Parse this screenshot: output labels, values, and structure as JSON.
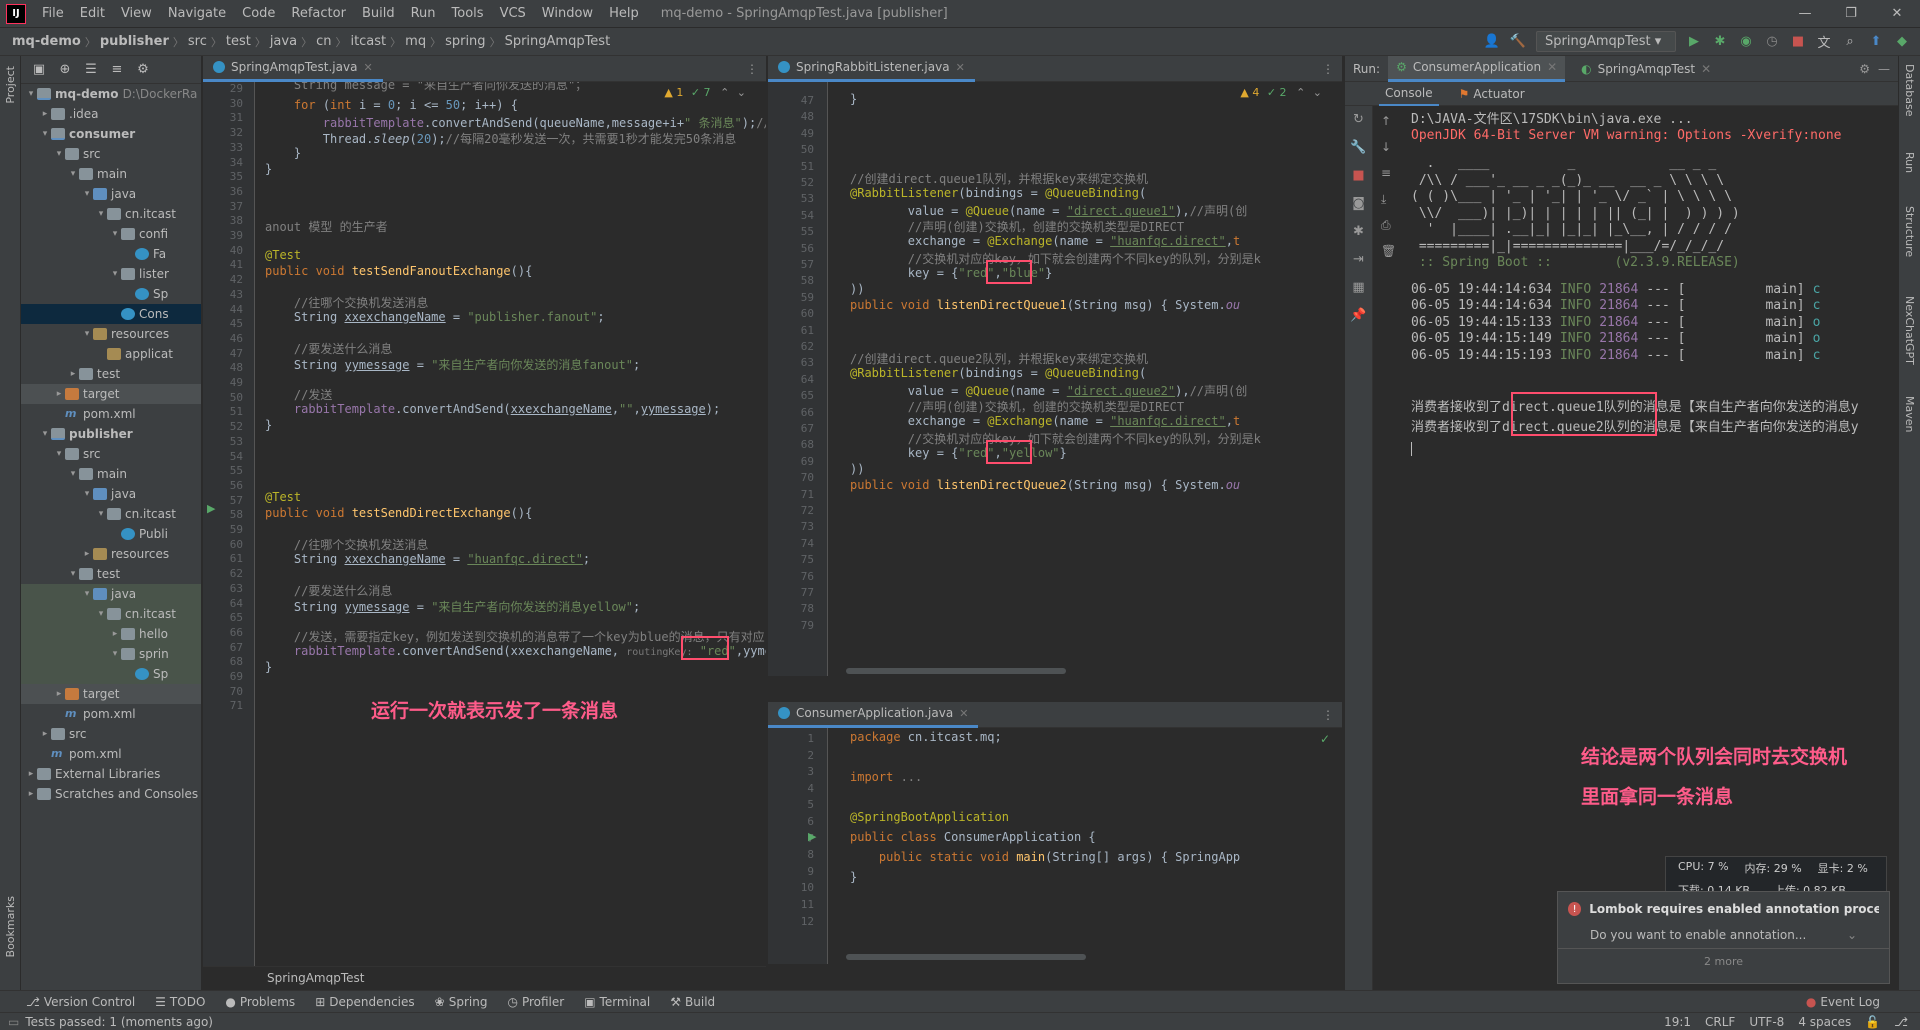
{
  "window": {
    "title": "mq-demo - SpringAmqpTest.java [publisher]",
    "logo": "IJ",
    "menu": [
      "File",
      "Edit",
      "View",
      "Navigate",
      "Code",
      "Refactor",
      "Build",
      "Run",
      "Tools",
      "VCS",
      "Window",
      "Help"
    ],
    "controls": [
      "—",
      "❐",
      "✕"
    ]
  },
  "breadcrumb": [
    "mq-demo",
    "publisher",
    "src",
    "test",
    "java",
    "cn",
    "itcast",
    "mq",
    "spring",
    "SpringAmqpTest"
  ],
  "run_config": "SpringAmqpTest",
  "left_strip": {
    "project": "Project",
    "bookmarks": "Bookmarks"
  },
  "right_strip": [
    "Database",
    "Run",
    "Structure",
    "NexChatGPT",
    "Maven"
  ],
  "project_tree": [
    {
      "depth": 0,
      "arrow": "▾",
      "icon": "mod",
      "label": "mq-demo",
      "suffix": "D:\\DockerRa",
      "bold": true
    },
    {
      "depth": 1,
      "arrow": "▸",
      "icon": "folder",
      "label": ".idea"
    },
    {
      "depth": 1,
      "arrow": "▾",
      "icon": "mod",
      "label": "consumer",
      "bold": true
    },
    {
      "depth": 2,
      "arrow": "▾",
      "icon": "folder",
      "label": "src"
    },
    {
      "depth": 3,
      "arrow": "▾",
      "icon": "folder",
      "label": "main"
    },
    {
      "depth": 4,
      "arrow": "▾",
      "icon": "src",
      "label": "java"
    },
    {
      "depth": 5,
      "arrow": "▾",
      "icon": "folder",
      "label": "cn.itcast"
    },
    {
      "depth": 6,
      "arrow": "▾",
      "icon": "folder",
      "label": "confi"
    },
    {
      "depth": 7,
      "arrow": "",
      "icon": "cls",
      "label": "Fa"
    },
    {
      "depth": 6,
      "arrow": "▾",
      "icon": "folder",
      "label": "lister"
    },
    {
      "depth": 7,
      "arrow": "",
      "icon": "cls",
      "label": "Sp"
    },
    {
      "depth": 6,
      "arrow": "",
      "icon": "cls",
      "label": "Cons",
      "selected": true
    },
    {
      "depth": 4,
      "arrow": "▾",
      "icon": "res",
      "label": "resources"
    },
    {
      "depth": 5,
      "arrow": "",
      "icon": "res",
      "label": "applicat"
    },
    {
      "depth": 3,
      "arrow": "▸",
      "icon": "folder",
      "label": "test"
    },
    {
      "depth": 2,
      "arrow": "▸",
      "icon": "target",
      "label": "target",
      "hl": true
    },
    {
      "depth": 2,
      "arrow": "",
      "icon": "pom",
      "label": "pom.xml"
    },
    {
      "depth": 1,
      "arrow": "▾",
      "icon": "mod",
      "label": "publisher",
      "bold": true
    },
    {
      "depth": 2,
      "arrow": "▾",
      "icon": "folder",
      "label": "src"
    },
    {
      "depth": 3,
      "arrow": "▾",
      "icon": "folder",
      "label": "main"
    },
    {
      "depth": 4,
      "arrow": "▾",
      "icon": "src",
      "label": "java"
    },
    {
      "depth": 5,
      "arrow": "▾",
      "icon": "folder",
      "label": "cn.itcast"
    },
    {
      "depth": 6,
      "arrow": "",
      "icon": "cls",
      "label": "Publi"
    },
    {
      "depth": 4,
      "arrow": "▸",
      "icon": "res",
      "label": "resources"
    },
    {
      "depth": 3,
      "arrow": "▾",
      "icon": "folder",
      "label": "test"
    },
    {
      "depth": 4,
      "arrow": "▾",
      "icon": "src",
      "label": "java",
      "test": true
    },
    {
      "depth": 5,
      "arrow": "▾",
      "icon": "folder",
      "label": "cn.itcast",
      "test": true
    },
    {
      "depth": 6,
      "arrow": "▸",
      "icon": "folder",
      "label": "hello",
      "test": true
    },
    {
      "depth": 6,
      "arrow": "▾",
      "icon": "folder",
      "label": "sprin",
      "test": true
    },
    {
      "depth": 7,
      "arrow": "",
      "icon": "cls",
      "label": "Sp",
      "test": true
    },
    {
      "depth": 2,
      "arrow": "▸",
      "icon": "target",
      "label": "target",
      "hl": true
    },
    {
      "depth": 2,
      "arrow": "",
      "icon": "pom",
      "label": "pom.xml"
    },
    {
      "depth": 1,
      "arrow": "▸",
      "icon": "folder",
      "label": "src"
    },
    {
      "depth": 1,
      "arrow": "",
      "icon": "pom",
      "label": "pom.xml"
    },
    {
      "depth": 0,
      "arrow": "▸",
      "icon": "folder",
      "label": "External Libraries"
    },
    {
      "depth": 0,
      "arrow": "▸",
      "icon": "folder",
      "label": "Scratches and Consoles"
    }
  ],
  "editor1": {
    "tab": "SpringAmqpTest.java",
    "inspections": {
      "warn": "▲ 1",
      "ok": "✓ 7"
    },
    "first_line": 29,
    "footer": "SpringAmqpTest",
    "annotation_text": "运行一次就表示发了一条消息"
  },
  "editor2": {
    "tab": "SpringRabbitListener.java",
    "inspections": {
      "warn": "▲ 4",
      "ok": "✓ 2"
    },
    "first_line": 47
  },
  "editor3": {
    "tab": "ConsumerApplication.java",
    "first_line": 1
  },
  "run_panel": {
    "label": "Run:",
    "tabs": [
      "ConsumerApplication",
      "SpringAmqpTest"
    ],
    "subtabs": [
      "Console",
      "Actuator"
    ],
    "console": {
      "cmd": "D:\\JAVA-文件区\\17SDK\\bin\\java.exe ...",
      "warn": "OpenJDK 64-Bit Server VM warning: Options -Xverify:none",
      "banner": [
        "  .   ____          _            __ _ _",
        " /\\\\ / ___'_ __ _ _(_)_ __  __ _ \\ \\ \\ \\",
        "( ( )\\___ | '_ | '_| | '_ \\/ _` | \\ \\ \\ \\",
        " \\\\/  ___)| |_)| | | | | || (_| |  ) ) ) )",
        "  '  |____| .__|_| |_|_| |_\\__, | / / / /",
        " =========|_|==============|___/=/_/_/_/",
        " :: Spring Boot ::        (v2.3.9.RELEASE)"
      ],
      "logs": [
        {
          "time": "06-05 19:44:14:634",
          "level": "INFO",
          "pid": "21864",
          "sep": "--- [",
          "thread": "main]",
          "cls": "c"
        },
        {
          "time": "06-05 19:44:14:634",
          "level": "INFO",
          "pid": "21864",
          "sep": "--- [",
          "thread": "main]",
          "cls": "c"
        },
        {
          "time": "06-05 19:44:15:133",
          "level": "INFO",
          "pid": "21864",
          "sep": "--- [",
          "thread": "main]",
          "cls": "o"
        },
        {
          "time": "06-05 19:44:15:149",
          "level": "INFO",
          "pid": "21864",
          "sep": "--- [",
          "thread": "main]",
          "cls": "o"
        },
        {
          "time": "06-05 19:44:15:193",
          "level": "INFO",
          "pid": "21864",
          "sep": "--- [",
          "thread": "main]",
          "cls": "c"
        }
      ],
      "msg1": "消费者接收到了direct.queue1队列的消息是【来自生产者向你发送的消息y",
      "msg2": "消费者接收到了direct.queue2队列的消息是【来自生产者向你发送的消息y"
    },
    "annotation_line1": "结论是两个队列会同时去交换机",
    "annotation_line2": "里面拿同一条消息"
  },
  "sysmon": {
    "cpu": "CPU: 7 %",
    "mem": "内存: 29 %",
    "gpu": "显卡: 2 %",
    "down": "下载: 0.14 KB",
    "up": "上传: 0.82 KB"
  },
  "lombok": {
    "title": "Lombok requires enabled annotation process",
    "body": "Do you want to enable annotation...",
    "more": "2 more"
  },
  "bottom_tabs": [
    "Version Control",
    "TODO",
    "Problems",
    "Dependencies",
    "Spring",
    "Profiler",
    "Terminal",
    "Build"
  ],
  "event_log": "Event Log",
  "status": {
    "left": "Tests passed: 1 (moments ago)",
    "pos": "19:1",
    "eol": "CRLF",
    "enc": "UTF-8",
    "indent": "4 spaces"
  },
  "colors": {
    "accent": "#4a88c7",
    "annotation": "#ff5c8a",
    "keyword": "#cc7832",
    "string": "#6a8759"
  }
}
